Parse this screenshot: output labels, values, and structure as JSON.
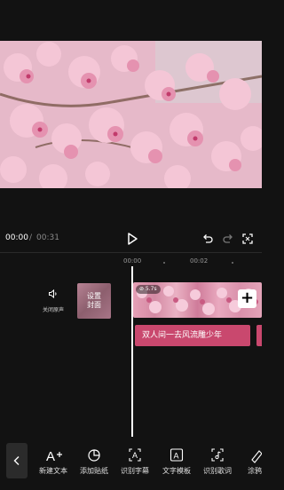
{
  "playback": {
    "current_time": "00:00",
    "separator": "/",
    "total_time": "00:31"
  },
  "ruler": {
    "ticks": [
      "00:00",
      "00:02"
    ]
  },
  "track": {
    "mute_label": "关闭原声",
    "cover_label_line1": "设置",
    "cover_label_line2": "封面",
    "clip_badge": "⊘ 5.7s",
    "text_clip": "双人间一去风流雕少年"
  },
  "toolbar": {
    "tools": [
      {
        "label": "新建文本",
        "icon": "text-plus-icon"
      },
      {
        "label": "添加贴纸",
        "icon": "sticker-icon"
      },
      {
        "label": "识别字幕",
        "icon": "subtitle-recognize-icon"
      },
      {
        "label": "文字模板",
        "icon": "text-template-icon"
      },
      {
        "label": "识别歌词",
        "icon": "lyrics-recognize-icon"
      },
      {
        "label": "涂鸦",
        "icon": "doodle-icon"
      }
    ]
  },
  "colors": {
    "text_clip": "#c9486e",
    "background": "#121212"
  }
}
